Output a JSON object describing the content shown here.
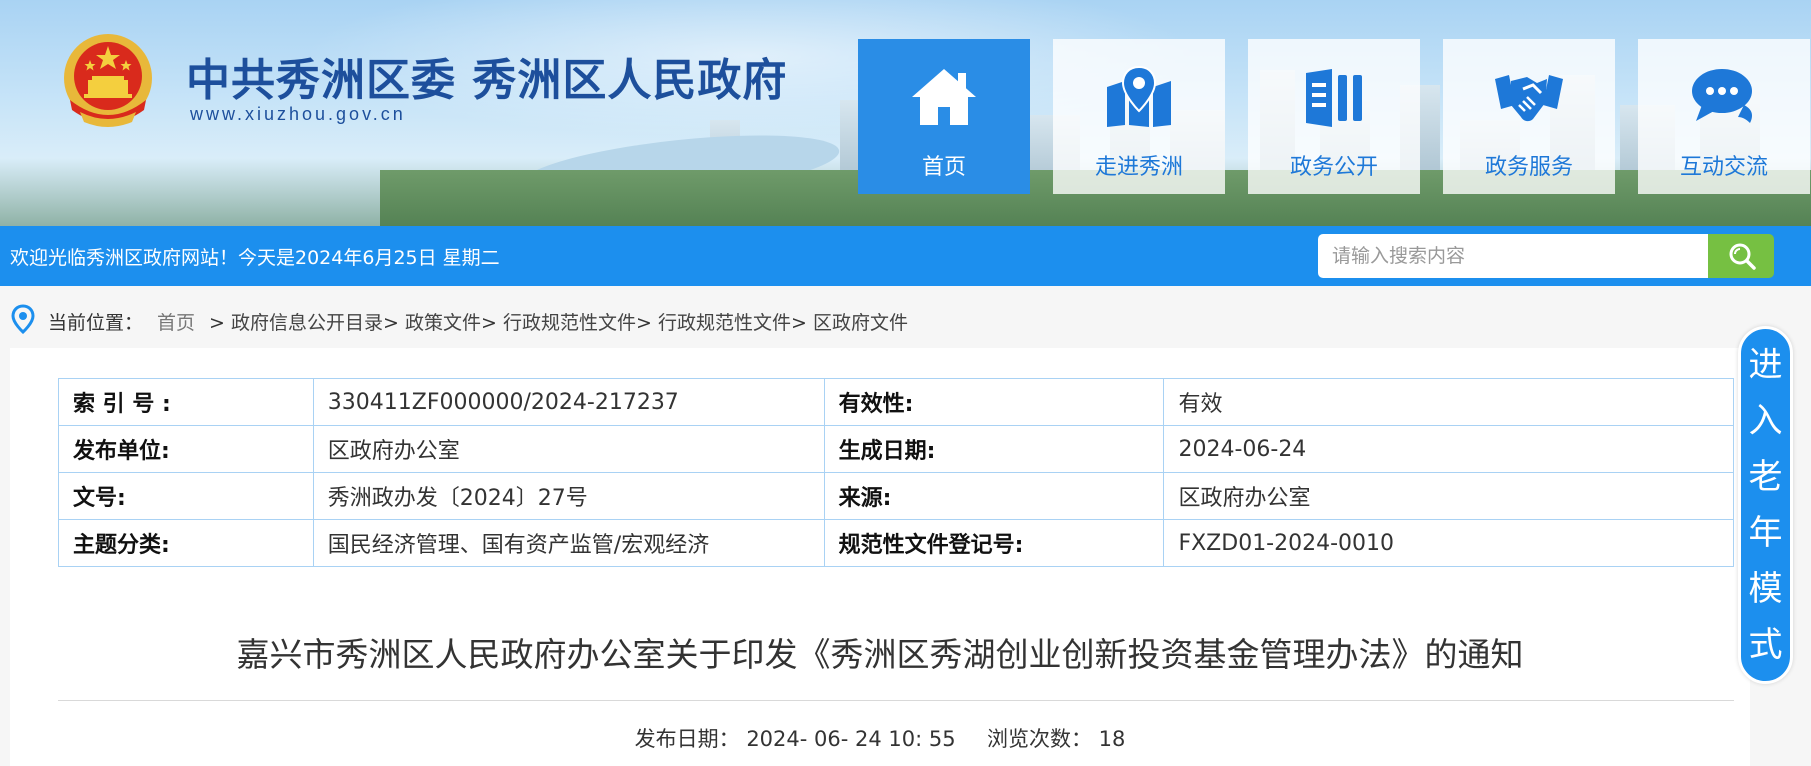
{
  "header": {
    "site_title": "中共秀洲区委 秀洲区人民政府",
    "site_domain": "www.xiuzhou.gov.cn",
    "nav": [
      {
        "label": "首页",
        "icon": "home-icon",
        "active": true
      },
      {
        "label": "走进秀洲",
        "icon": "map-pin-icon",
        "active": false
      },
      {
        "label": "政务公开",
        "icon": "columns-icon",
        "active": false
      },
      {
        "label": "政务服务",
        "icon": "handshake-icon",
        "active": false
      },
      {
        "label": "互动交流",
        "icon": "chat-bubble-icon",
        "active": false
      }
    ],
    "colors": {
      "nav_active": "#2a8de6",
      "nav_text": "#1e78d8",
      "title": "#1d4f9c"
    }
  },
  "welcome_bar": {
    "text": "欢迎光临秀洲区政府网站！今天是2024年6月25日 星期二",
    "search_placeholder": "请输入搜索内容",
    "search_icon": "search-icon",
    "colors": {
      "bar": "#1c8fee",
      "search_button": "#76c042"
    }
  },
  "breadcrumb": {
    "label": "当前位置：",
    "items": [
      "首页",
      "政府信息公开目录",
      "政策文件",
      "行政规范性文件",
      "行政规范性文件",
      "区政府文件"
    ],
    "separator": ">"
  },
  "meta_table": {
    "rows": [
      {
        "k1": "索 引 号 :",
        "v1": "330411ZF000000/2024-217237",
        "k2": "有效性:",
        "v2": "有效"
      },
      {
        "k1": "发布单位:",
        "v1": "区政府办公室",
        "k2": "生成日期:",
        "v2": "2024-06-24"
      },
      {
        "k1": "文号:",
        "v1": "秀洲政办发〔2024〕27号",
        "k2": "来源:",
        "v2": "区政府办公室"
      },
      {
        "k1": "主题分类:",
        "v1": "国民经济管理、国有资产监管/宏观经济",
        "k2": "规范性文件登记号:",
        "v2": "FXZD01-2024-0010"
      }
    ]
  },
  "document": {
    "title": "嘉兴市秀洲区人民政府办公室关于印发《秀洲区秀湖创业创新投资基金管理办法》的通知",
    "publish_label": "发布日期：",
    "publish_date": "2024- 06- 24 10: 55",
    "views_label": "浏览次数：",
    "views": "18"
  },
  "elder_mode": {
    "chars": [
      "进",
      "入",
      "老",
      "年",
      "模",
      "式"
    ]
  }
}
